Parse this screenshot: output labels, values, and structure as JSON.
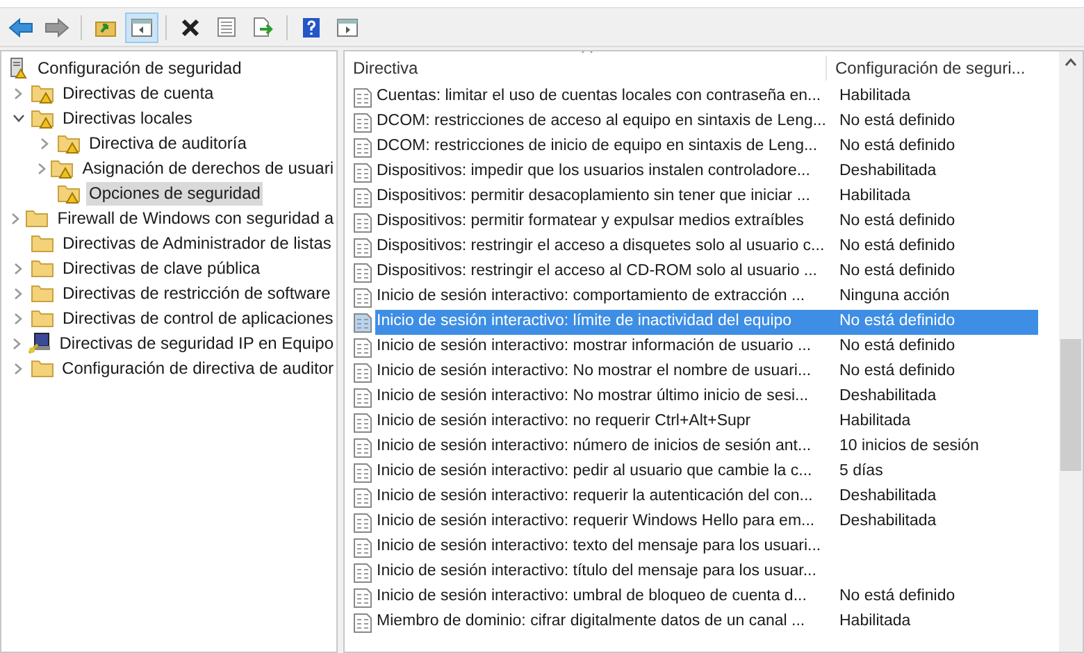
{
  "toolbar": [
    {
      "kind": "back",
      "pressed": false
    },
    {
      "kind": "forward",
      "pressed": false
    },
    {
      "kind": "up",
      "pressed": false
    },
    {
      "kind": "tree",
      "pressed": true
    },
    {
      "kind": "delete",
      "pressed": false
    },
    {
      "kind": "properties",
      "pressed": false
    },
    {
      "kind": "export",
      "pressed": false
    },
    {
      "kind": "help",
      "pressed": false
    },
    {
      "kind": "pane",
      "pressed": false
    }
  ],
  "tree": {
    "label": "Configuración de seguridad",
    "kind": "root",
    "selected": false,
    "children": [
      {
        "label": "Directivas de cuenta",
        "kind": "secured",
        "expandable": true,
        "expanded": false,
        "selected": false
      },
      {
        "label": "Directivas locales",
        "kind": "secured",
        "expandable": true,
        "expanded": true,
        "selected": false,
        "children": [
          {
            "label": "Directiva de auditoría",
            "kind": "secured",
            "expandable": true,
            "expanded": false,
            "selected": false
          },
          {
            "label": "Asignación de derechos de usuari",
            "kind": "secured",
            "expandable": true,
            "expanded": false,
            "selected": false
          },
          {
            "label": "Opciones de seguridad",
            "kind": "secured",
            "expandable": false,
            "selected": true
          }
        ]
      },
      {
        "label": "Firewall de Windows con seguridad a",
        "kind": "folder",
        "expandable": true,
        "expanded": false,
        "selected": false
      },
      {
        "label": "Directivas de Administrador de listas",
        "kind": "folder",
        "expandable": false,
        "selected": false
      },
      {
        "label": "Directivas de clave pública",
        "kind": "folder",
        "expandable": true,
        "expanded": false,
        "selected": false
      },
      {
        "label": "Directivas de restricción de software",
        "kind": "folder",
        "expandable": true,
        "expanded": false,
        "selected": false
      },
      {
        "label": "Directivas de control de aplicaciones",
        "kind": "folder",
        "expandable": true,
        "expanded": false,
        "selected": false
      },
      {
        "label": "Directivas de seguridad IP en Equipo",
        "kind": "network",
        "expandable": true,
        "expanded": false,
        "selected": false
      },
      {
        "label": "Configuración de directiva de auditor",
        "kind": "folder",
        "expandable": true,
        "expanded": false,
        "selected": false
      }
    ]
  },
  "table": {
    "columns": [
      "Directiva",
      "Configuración de seguri..."
    ],
    "rows": [
      {
        "policy": "Cuentas: limitar el uso de cuentas locales con contraseña en...",
        "setting": "Habilitada",
        "selected": false
      },
      {
        "policy": "DCOM: restricciones de acceso al equipo en sintaxis de Leng...",
        "setting": "No está definido",
        "selected": false
      },
      {
        "policy": "DCOM: restricciones de inicio de equipo en sintaxis de Leng...",
        "setting": "No está definido",
        "selected": false
      },
      {
        "policy": "Dispositivos: impedir que los usuarios instalen controladore...",
        "setting": "Deshabilitada",
        "selected": false
      },
      {
        "policy": "Dispositivos: permitir desacoplamiento sin tener que iniciar ...",
        "setting": "Habilitada",
        "selected": false
      },
      {
        "policy": "Dispositivos: permitir formatear y expulsar medios extraíbles",
        "setting": "No está definido",
        "selected": false
      },
      {
        "policy": "Dispositivos: restringir el acceso a disquetes solo al usuario c...",
        "setting": "No está definido",
        "selected": false
      },
      {
        "policy": "Dispositivos: restringir el acceso al CD-ROM solo al usuario ...",
        "setting": "No está definido",
        "selected": false
      },
      {
        "policy": "Inicio de sesión interactivo: comportamiento de extracción ...",
        "setting": "Ninguna acción",
        "selected": false
      },
      {
        "policy": "Inicio de sesión interactivo: límite de inactividad del equipo",
        "setting": "No está definido",
        "selected": true
      },
      {
        "policy": "Inicio de sesión interactivo: mostrar información de usuario ...",
        "setting": "No está definido",
        "selected": false
      },
      {
        "policy": "Inicio de sesión interactivo: No mostrar el nombre de usuari...",
        "setting": "No está definido",
        "selected": false
      },
      {
        "policy": "Inicio de sesión interactivo: No mostrar último inicio de sesi...",
        "setting": "Deshabilitada",
        "selected": false
      },
      {
        "policy": "Inicio de sesión interactivo: no requerir Ctrl+Alt+Supr",
        "setting": "Habilitada",
        "selected": false
      },
      {
        "policy": "Inicio de sesión interactivo: número de inicios de sesión ant...",
        "setting": "10 inicios de sesión",
        "selected": false
      },
      {
        "policy": "Inicio de sesión interactivo: pedir al usuario que cambie la c...",
        "setting": "5 días",
        "selected": false
      },
      {
        "policy": "Inicio de sesión interactivo: requerir la autenticación del con...",
        "setting": "Deshabilitada",
        "selected": false
      },
      {
        "policy": "Inicio de sesión interactivo: requerir Windows Hello para em...",
        "setting": "Deshabilitada",
        "selected": false
      },
      {
        "policy": "Inicio de sesión interactivo: texto del mensaje para los usuari...",
        "selected": false
      },
      {
        "policy": "Inicio de sesión interactivo: título del mensaje para los usuar...",
        "selected": false
      },
      {
        "policy": "Inicio de sesión interactivo: umbral de bloqueo de cuenta d...",
        "setting": "No está definido",
        "selected": false
      },
      {
        "policy": "Miembro de dominio: cifrar digitalmente datos de un canal ...",
        "setting": "Habilitada",
        "selected": false
      }
    ]
  }
}
